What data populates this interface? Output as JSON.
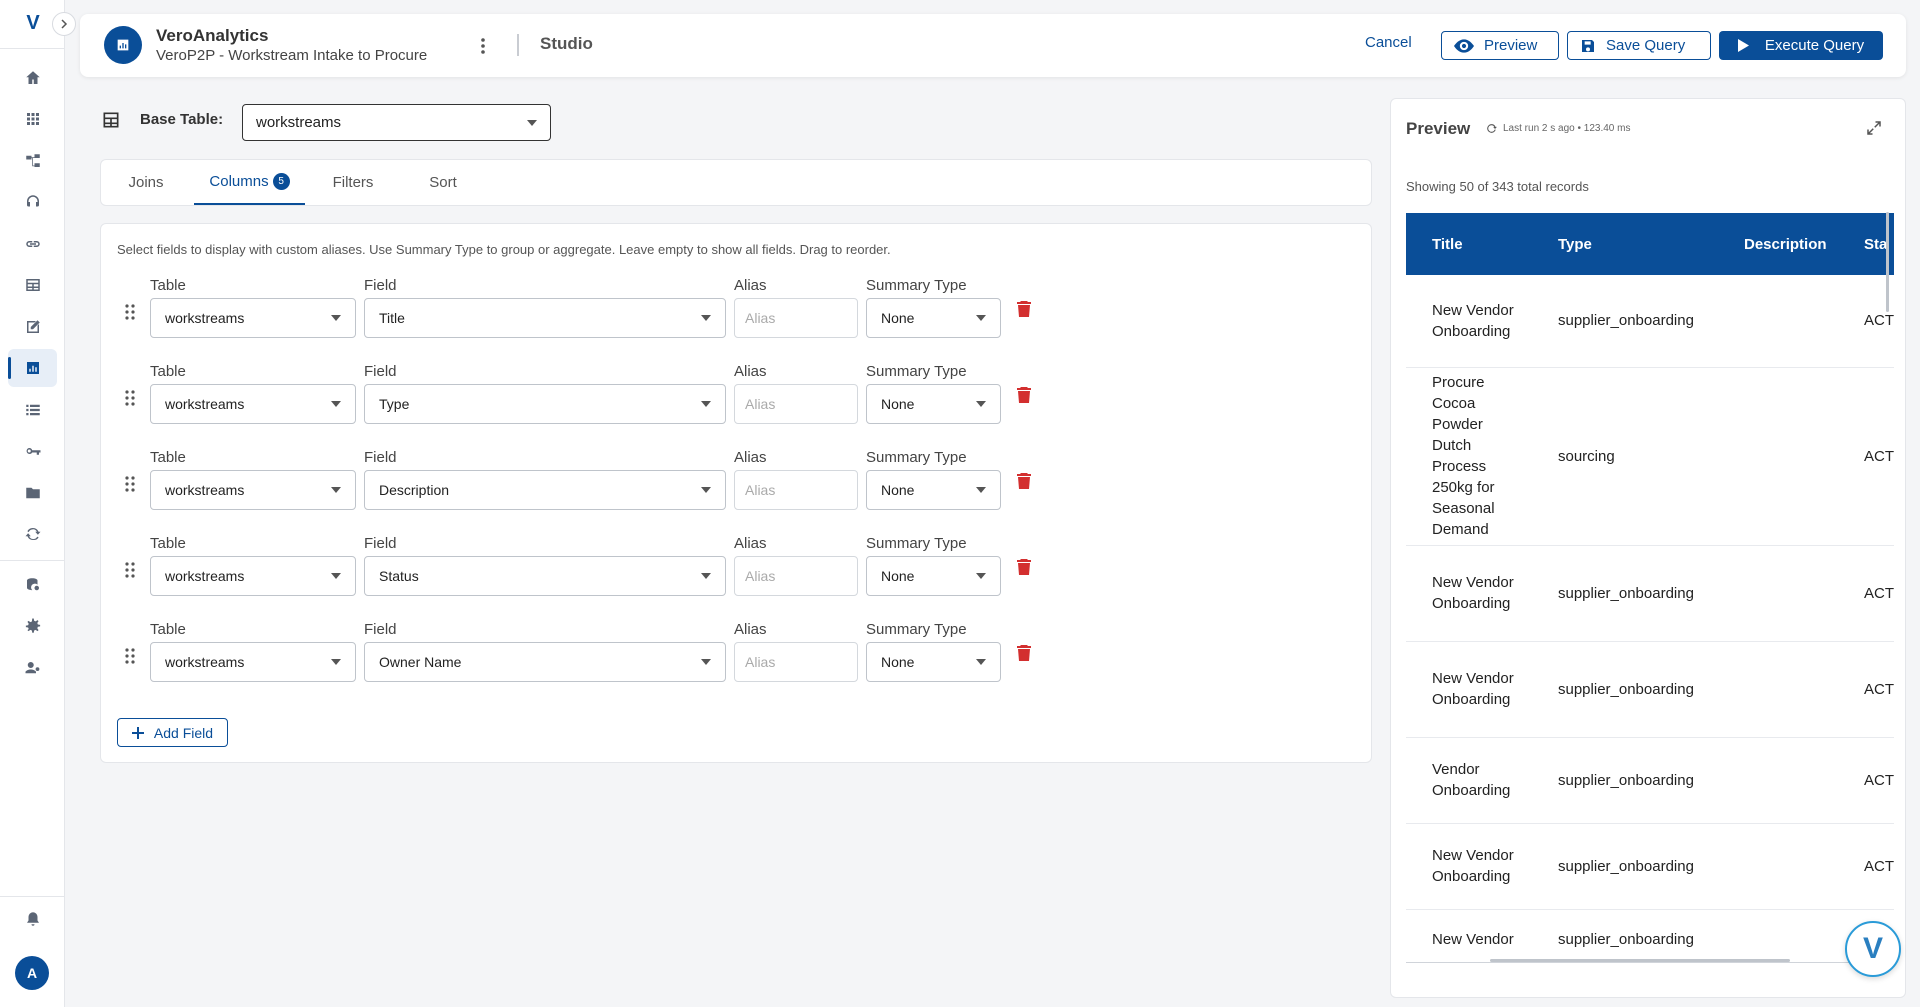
{
  "sidebar": {
    "logo": "V",
    "avatar_initial": "A",
    "items": [
      "home",
      "apps",
      "workflow",
      "support",
      "links",
      "table",
      "edit",
      "analytics",
      "list",
      "keys",
      "folder",
      "sync",
      "database-settings",
      "settings",
      "user-settings"
    ]
  },
  "header": {
    "app_name": "VeroAnalytics",
    "subtitle": "VeroP2P - Workstream Intake to Procure",
    "section": "Studio",
    "cancel_label": "Cancel",
    "preview_label": "Preview",
    "save_label": "Save Query",
    "execute_label": "Execute Query"
  },
  "base_table": {
    "label": "Base Table:",
    "value": "workstreams"
  },
  "tabs": [
    {
      "label": "Joins"
    },
    {
      "label": "Columns",
      "badge": "5"
    },
    {
      "label": "Filters"
    },
    {
      "label": "Sort"
    }
  ],
  "columns": {
    "help_text": "Select fields to display with custom aliases. Use Summary Type to group or aggregate. Leave empty to show all fields. Drag to reorder.",
    "labels": {
      "table": "Table",
      "field": "Field",
      "alias": "Alias",
      "summary": "Summary Type"
    },
    "alias_placeholder": "Alias",
    "rows": [
      {
        "table": "workstreams",
        "field": "Title",
        "summary": "None"
      },
      {
        "table": "workstreams",
        "field": "Type",
        "summary": "None"
      },
      {
        "table": "workstreams",
        "field": "Description",
        "summary": "None"
      },
      {
        "table": "workstreams",
        "field": "Status",
        "summary": "None"
      },
      {
        "table": "workstreams",
        "field": "Owner Name",
        "summary": "None"
      }
    ],
    "add_label": "Add Field"
  },
  "preview": {
    "title": "Preview",
    "last_run": "Last run 2 s ago • 123.40 ms",
    "count_text": "Showing 50 of 343 total records",
    "headers": [
      "Title",
      "Type",
      "Description",
      "Sta"
    ],
    "rows": [
      {
        "title": "New Vendor Onboarding",
        "type": "supplier_onboarding",
        "description": "",
        "status": "ACT"
      },
      {
        "title": "Procure Cocoa Powder Dutch Process 250kg for Seasonal Demand",
        "type": "sourcing",
        "description": "",
        "status": "ACT"
      },
      {
        "title": "New Vendor Onboarding",
        "type": "supplier_onboarding",
        "description": "",
        "status": "ACT"
      },
      {
        "title": "New Vendor Onboarding",
        "type": "supplier_onboarding",
        "description": "",
        "status": "ACT"
      },
      {
        "title": "Vendor Onboarding",
        "type": "supplier_onboarding",
        "description": "",
        "status": "ACT"
      },
      {
        "title": "New Vendor Onboarding",
        "type": "supplier_onboarding",
        "description": "",
        "status": "ACT"
      },
      {
        "title": "New Vendor",
        "type": "supplier_onboarding",
        "description": "",
        "status": ""
      }
    ]
  },
  "assistant_fab": "V"
}
